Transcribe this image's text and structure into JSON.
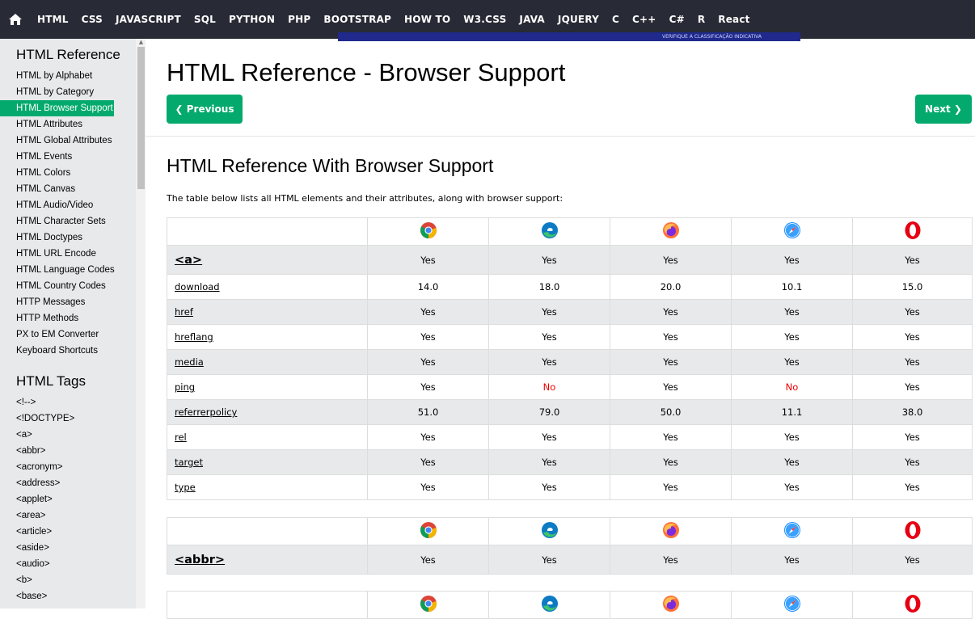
{
  "nav": {
    "items": [
      "HTML",
      "CSS",
      "JAVASCRIPT",
      "SQL",
      "PYTHON",
      "PHP",
      "BOOTSTRAP",
      "HOW TO",
      "W3.CSS",
      "JAVA",
      "JQUERY",
      "C",
      "C++",
      "C#",
      "R",
      "React"
    ]
  },
  "banner_text": "VERIFIQUE A CLASSIFICAÇÃO INDICATIVA",
  "sidebar": {
    "section1_title": "HTML Reference",
    "section1_items": [
      "HTML by Alphabet",
      "HTML by Category",
      "HTML Browser Support",
      "HTML Attributes",
      "HTML Global Attributes",
      "HTML Events",
      "HTML Colors",
      "HTML Canvas",
      "HTML Audio/Video",
      "HTML Character Sets",
      "HTML Doctypes",
      "HTML URL Encode",
      "HTML Language Codes",
      "HTML Country Codes",
      "HTTP Messages",
      "HTTP Methods",
      "PX to EM Converter",
      "Keyboard Shortcuts"
    ],
    "active_item": "HTML Browser Support",
    "section2_title": "HTML Tags",
    "section2_items": [
      "<!-->",
      "<!DOCTYPE>",
      "<a>",
      "<abbr>",
      "<acronym>",
      "<address>",
      "<applet>",
      "<area>",
      "<article>",
      "<aside>",
      "<audio>",
      "<b>",
      "<base>"
    ]
  },
  "main": {
    "title": "HTML Reference - Browser Support",
    "prev_label": "❮ Previous",
    "next_label": "Next ❯",
    "section_title": "HTML Reference With Browser Support",
    "intro": "The table below lists all HTML elements and their attributes, along with browser support:"
  },
  "browsers": [
    "chrome-icon",
    "edge-icon",
    "firefox-icon",
    "safari-icon",
    "opera-icon"
  ],
  "colors": {
    "accent": "#04AA6D",
    "nav_bg": "#282A35",
    "sidebar_bg": "#E7E9EB",
    "no": "#e00000"
  },
  "tables": [
    {
      "element": "<a>",
      "support": [
        "Yes",
        "Yes",
        "Yes",
        "Yes",
        "Yes"
      ],
      "attributes": [
        {
          "name": "download",
          "support": [
            "14.0",
            "18.0",
            "20.0",
            "10.1",
            "15.0"
          ]
        },
        {
          "name": "href",
          "support": [
            "Yes",
            "Yes",
            "Yes",
            "Yes",
            "Yes"
          ]
        },
        {
          "name": "hreflang",
          "support": [
            "Yes",
            "Yes",
            "Yes",
            "Yes",
            "Yes"
          ]
        },
        {
          "name": "media",
          "support": [
            "Yes",
            "Yes",
            "Yes",
            "Yes",
            "Yes"
          ]
        },
        {
          "name": "ping",
          "support": [
            "Yes",
            "No",
            "Yes",
            "No",
            "Yes"
          ]
        },
        {
          "name": "referrerpolicy",
          "support": [
            "51.0",
            "79.0",
            "50.0",
            "11.1",
            "38.0"
          ]
        },
        {
          "name": "rel",
          "support": [
            "Yes",
            "Yes",
            "Yes",
            "Yes",
            "Yes"
          ]
        },
        {
          "name": "target",
          "support": [
            "Yes",
            "Yes",
            "Yes",
            "Yes",
            "Yes"
          ]
        },
        {
          "name": "type",
          "support": [
            "Yes",
            "Yes",
            "Yes",
            "Yes",
            "Yes"
          ]
        }
      ]
    },
    {
      "element": "<abbr>",
      "support": [
        "Yes",
        "Yes",
        "Yes",
        "Yes",
        "Yes"
      ],
      "attributes": []
    },
    {
      "element": "",
      "support": [],
      "attributes": []
    }
  ]
}
